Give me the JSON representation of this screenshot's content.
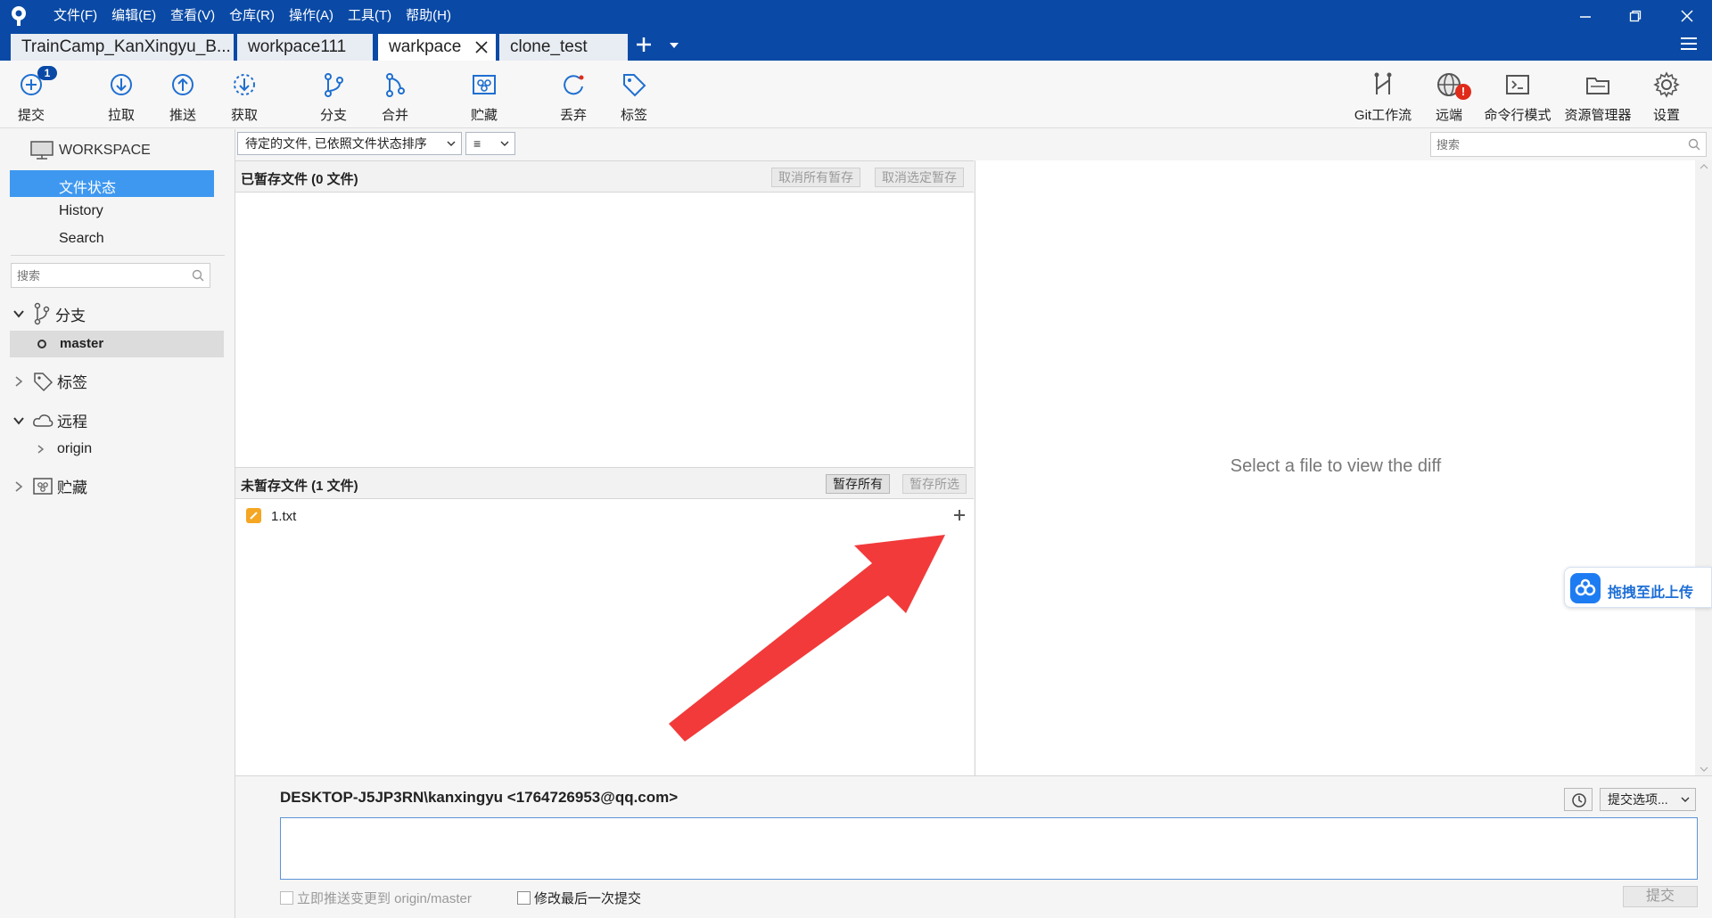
{
  "menu": [
    "文件(F)",
    "编辑(E)",
    "查看(V)",
    "仓库(R)",
    "操作(A)",
    "工具(T)",
    "帮助(H)"
  ],
  "tabs": [
    {
      "label": "TrainCamp_KanXingyu_B...",
      "active": false
    },
    {
      "label": "workpace111",
      "active": false
    },
    {
      "label": "warkpace",
      "active": true
    },
    {
      "label": "clone_test",
      "active": false
    }
  ],
  "toolbar": {
    "commit": "提交",
    "commit_badge": "1",
    "pull": "拉取",
    "push": "推送",
    "fetch": "获取",
    "branch": "分支",
    "merge": "合并",
    "stash": "贮藏",
    "discard": "丢弃",
    "tag": "标签",
    "gitflow": "Git工作流",
    "remote": "远端",
    "remote_alert": "!",
    "terminal": "命令行模式",
    "explorer": "资源管理器",
    "settings": "设置"
  },
  "sidebar": {
    "workspace": "WORKSPACE",
    "file_status": "文件状态",
    "history": "History",
    "search": "Search",
    "search_placeholder": "搜索",
    "branches": "分支",
    "current_branch": "master",
    "tags": "标签",
    "remotes": "远程",
    "origin": "origin",
    "stashes": "贮藏"
  },
  "filter": {
    "sort_label": "待定的文件, 已依照文件状态排序",
    "view_icon": "≡",
    "search_placeholder": "搜索"
  },
  "staged": {
    "title": "已暂存文件   (0 文件)",
    "unstage_all": "取消所有暂存",
    "unstage_selected": "取消选定暂存"
  },
  "unstaged": {
    "title": "未暂存文件   (1 文件)",
    "stage_all": "暂存所有",
    "stage_selected": "暂存所选",
    "files": [
      {
        "name": "1.txt",
        "status_color": "#f5a623"
      }
    ]
  },
  "diff": {
    "placeholder": "Select a file to view the diff"
  },
  "upload": {
    "label": "拖拽至此上传"
  },
  "commit": {
    "author": "DESKTOP-J5JP3RN\\kanxingyu <1764726953@qq.com>",
    "options": "提交选项...",
    "push_immediately": "立即推送变更到 origin/master",
    "amend": "修改最后一次提交",
    "submit": "提交"
  },
  "colors": {
    "brand": "#0a4aa6",
    "selection": "#3e98f0",
    "arrow": "#f23a3a"
  }
}
